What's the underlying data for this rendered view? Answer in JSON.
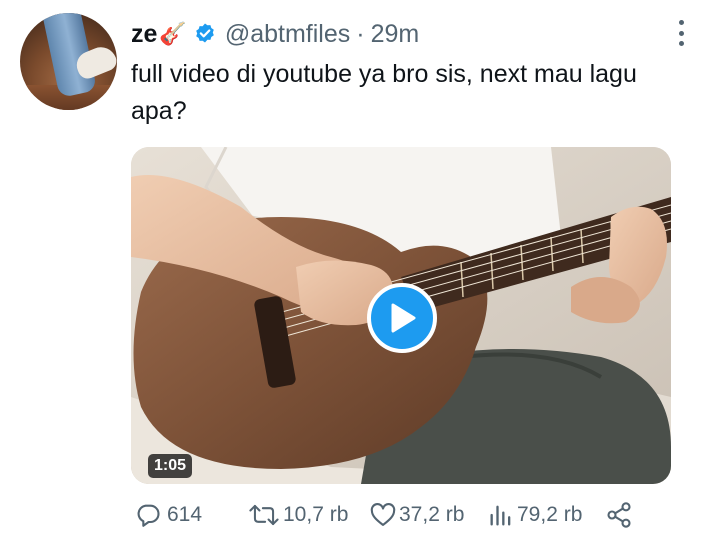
{
  "user": {
    "name": "ze",
    "emoji": "🎸",
    "handle": "@abtmfiles",
    "separator": "·",
    "time": "29m",
    "verified": true
  },
  "tweet": {
    "text": "full video di youtube ya bro sis, next mau lagu apa?"
  },
  "media": {
    "type": "video",
    "duration": "1:05"
  },
  "actions": {
    "reply_count": "614",
    "retweet_count": "10,7 rb",
    "like_count": "37,2 rb",
    "view_count": "79,2 rb"
  },
  "icons": {
    "verified": "verified-badge-icon",
    "more": "more-vertical-icon",
    "play": "play-icon",
    "reply": "reply-icon",
    "retweet": "retweet-icon",
    "like": "heart-icon",
    "views": "views-bar-chart-icon",
    "share": "share-icon"
  },
  "colors": {
    "accent": "#1d9bf0",
    "secondary_text": "#536471",
    "primary_text": "#0f1419"
  }
}
